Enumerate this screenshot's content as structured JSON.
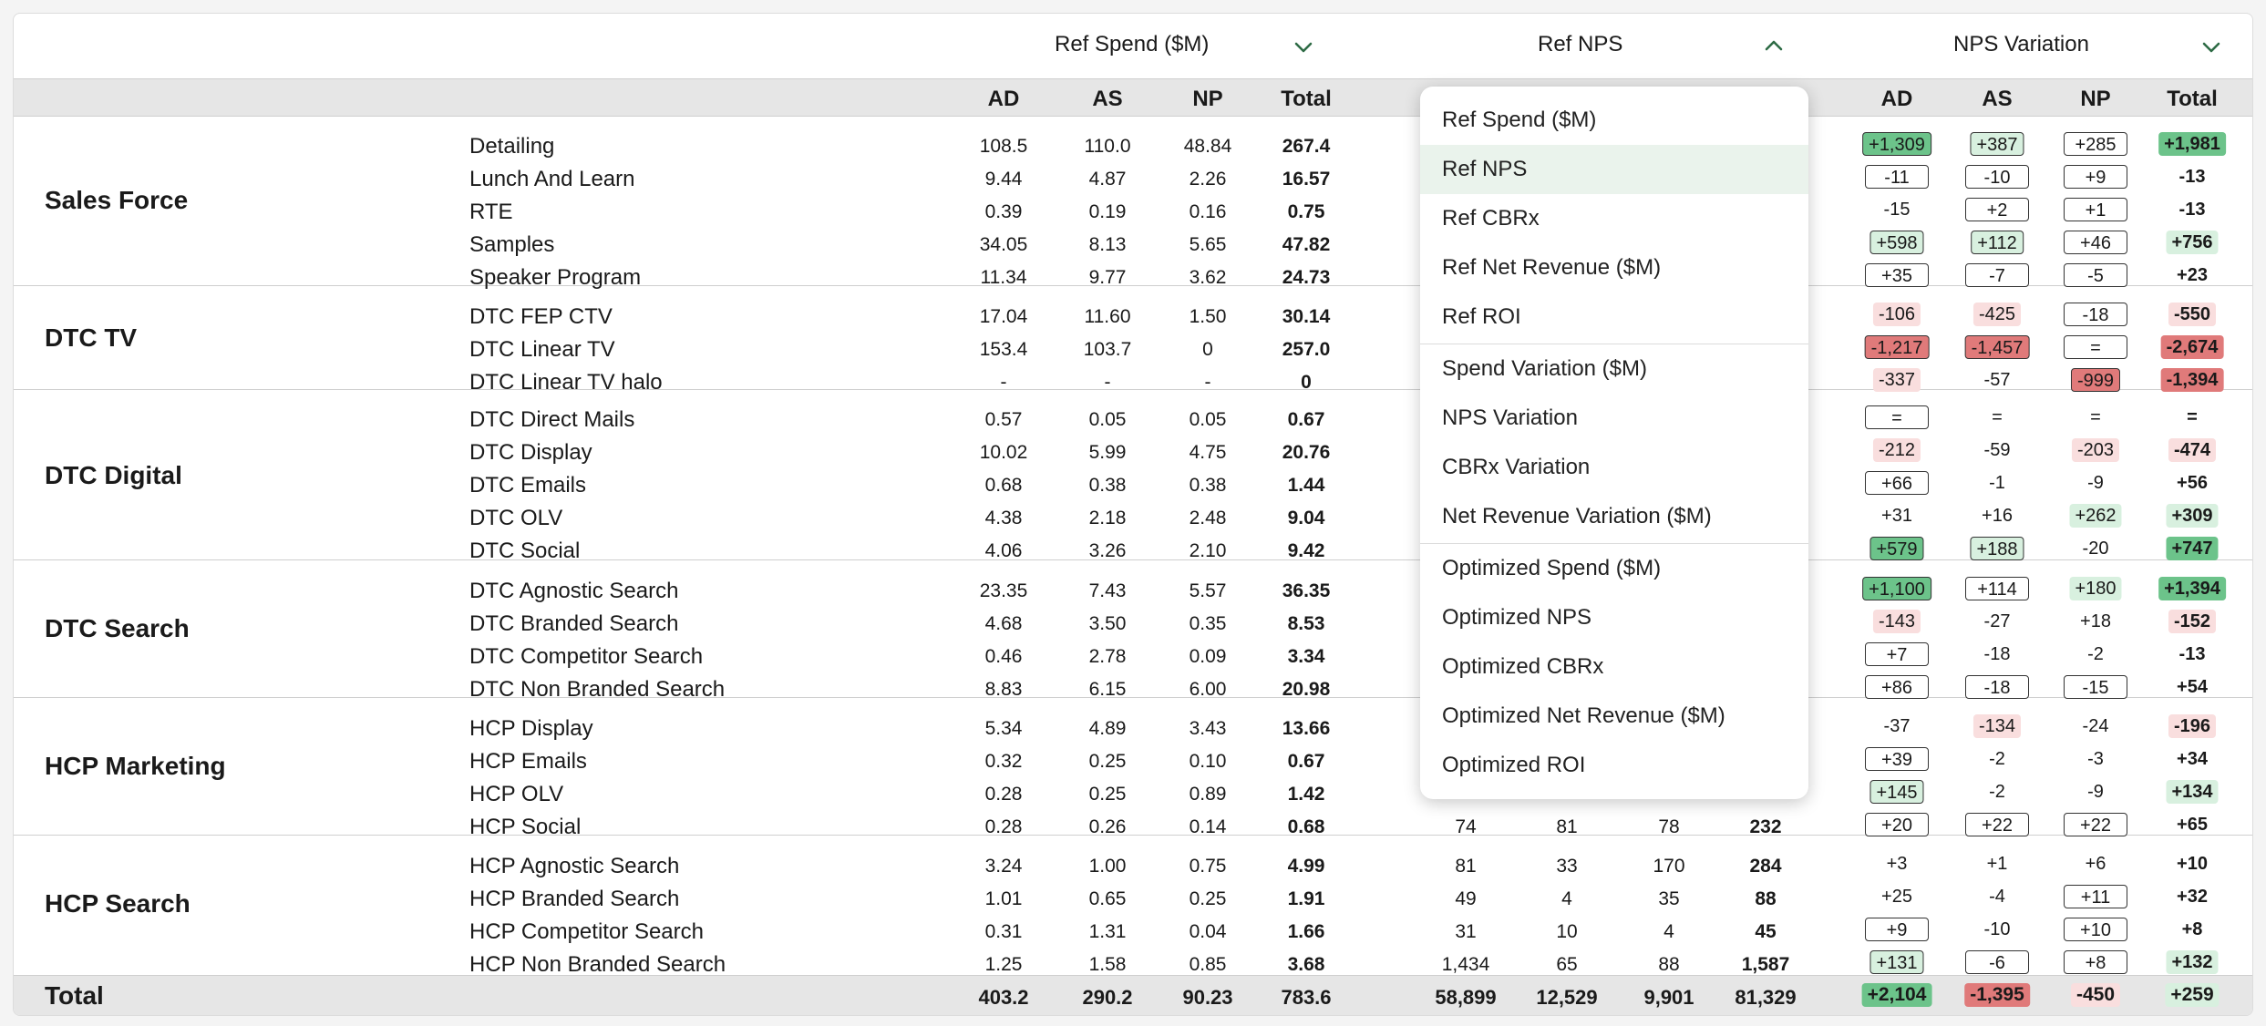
{
  "header": {
    "group1": "Ref Spend ($M)",
    "group2": "Ref NPS",
    "group3": "NPS Variation"
  },
  "subheader": {
    "spend": [
      "AD",
      "AS",
      "NP",
      "Total"
    ],
    "variation": [
      "AD",
      "AS",
      "NP",
      "Total"
    ]
  },
  "sections": [
    {
      "name": "Sales Force"
    },
    {
      "name": "DTC TV"
    },
    {
      "name": "DTC Digital"
    },
    {
      "name": "DTC Search"
    },
    {
      "name": "HCP Marketing"
    },
    {
      "name": "HCP Search"
    }
  ],
  "rows": [
    {
      "channel": "Detailing",
      "spend": [
        "108.5",
        "110.0",
        "48.84",
        "267.4"
      ],
      "nps": [],
      "var": [
        "+1,309",
        "+387",
        "+285",
        "+1,981"
      ]
    },
    {
      "channel": "Lunch And Learn",
      "spend": [
        "9.44",
        "4.87",
        "2.26",
        "16.57"
      ],
      "nps": [],
      "var": [
        "-11",
        "-10",
        "+9",
        "-13"
      ]
    },
    {
      "channel": "RTE",
      "spend": [
        "0.39",
        "0.19",
        "0.16",
        "0.75"
      ],
      "nps": [],
      "var": [
        "-15",
        "+2",
        "+1",
        "-13"
      ]
    },
    {
      "channel": "Samples",
      "spend": [
        "34.05",
        "8.13",
        "5.65",
        "47.82"
      ],
      "nps": [],
      "var": [
        "+598",
        "+112",
        "+46",
        "+756"
      ]
    },
    {
      "channel": "Speaker Program",
      "spend": [
        "11.34",
        "9.77",
        "3.62",
        "24.73"
      ],
      "nps": [],
      "var": [
        "+35",
        "-7",
        "-5",
        "+23"
      ]
    },
    {
      "channel": "DTC FEP CTV",
      "spend": [
        "17.04",
        "11.60",
        "1.50",
        "30.14"
      ],
      "nps": [],
      "var": [
        "-106",
        "-425",
        "-18",
        "-550"
      ]
    },
    {
      "channel": "DTC Linear TV",
      "spend": [
        "153.4",
        "103.7",
        "0",
        "257.0"
      ],
      "nps": [],
      "var": [
        "-1,217",
        "-1,457",
        "=",
        "-2,674"
      ]
    },
    {
      "channel": "DTC Linear TV halo",
      "spend": [
        "-",
        "-",
        "-",
        "0"
      ],
      "nps": [],
      "var": [
        "-337",
        "-57",
        "-999",
        "-1,394"
      ]
    },
    {
      "channel": "DTC Direct Mails",
      "spend": [
        "0.57",
        "0.05",
        "0.05",
        "0.67"
      ],
      "nps": [],
      "var": [
        "=",
        "=",
        "=",
        "="
      ]
    },
    {
      "channel": "DTC Display",
      "spend": [
        "10.02",
        "5.99",
        "4.75",
        "20.76"
      ],
      "nps": [],
      "var": [
        "-212",
        "-59",
        "-203",
        "-474"
      ]
    },
    {
      "channel": "DTC Emails",
      "spend": [
        "0.68",
        "0.38",
        "0.38",
        "1.44"
      ],
      "nps": [],
      "var": [
        "+66",
        "-1",
        "-9",
        "+56"
      ]
    },
    {
      "channel": "DTC OLV",
      "spend": [
        "4.38",
        "2.18",
        "2.48",
        "9.04"
      ],
      "nps": [],
      "var": [
        "+31",
        "+16",
        "+262",
        "+309"
      ]
    },
    {
      "channel": "DTC Social",
      "spend": [
        "4.06",
        "3.26",
        "2.10",
        "9.42"
      ],
      "nps": [],
      "var": [
        "+579",
        "+188",
        "-20",
        "+747"
      ]
    },
    {
      "channel": "DTC Agnostic Search",
      "spend": [
        "23.35",
        "7.43",
        "5.57",
        "36.35"
      ],
      "nps": [],
      "var": [
        "+1,100",
        "+114",
        "+180",
        "+1,394"
      ]
    },
    {
      "channel": "DTC Branded Search",
      "spend": [
        "4.68",
        "3.50",
        "0.35",
        "8.53"
      ],
      "nps": [],
      "var": [
        "-143",
        "-27",
        "+18",
        "-152"
      ]
    },
    {
      "channel": "DTC Competitor Search",
      "spend": [
        "0.46",
        "2.78",
        "0.09",
        "3.34"
      ],
      "nps": [],
      "var": [
        "+7",
        "-18",
        "-2",
        "-13"
      ]
    },
    {
      "channel": "DTC Non Branded Search",
      "spend": [
        "8.83",
        "6.15",
        "6.00",
        "20.98"
      ],
      "nps": [],
      "var": [
        "+86",
        "-18",
        "-15",
        "+54"
      ]
    },
    {
      "channel": "HCP Display",
      "spend": [
        "5.34",
        "4.89",
        "3.43",
        "13.66"
      ],
      "nps": [],
      "var": [
        "-37",
        "-134",
        "-24",
        "-196"
      ]
    },
    {
      "channel": "HCP Emails",
      "spend": [
        "0.32",
        "0.25",
        "0.10",
        "0.67"
      ],
      "nps": [],
      "var": [
        "+39",
        "-2",
        "-3",
        "+34"
      ]
    },
    {
      "channel": "HCP OLV",
      "spend": [
        "0.28",
        "0.25",
        "0.89",
        "1.42"
      ],
      "nps": [],
      "var": [
        "+145",
        "-2",
        "-9",
        "+134"
      ]
    },
    {
      "channel": "HCP Social",
      "spend": [
        "0.28",
        "0.26",
        "0.14",
        "0.68"
      ],
      "nps": [
        "74",
        "81",
        "78",
        "232"
      ],
      "var": [
        "+20",
        "+22",
        "+22",
        "+65"
      ]
    },
    {
      "channel": "HCP Agnostic Search",
      "spend": [
        "3.24",
        "1.00",
        "0.75",
        "4.99"
      ],
      "nps": [
        "81",
        "33",
        "170",
        "284"
      ],
      "var": [
        "+3",
        "+1",
        "+6",
        "+10"
      ]
    },
    {
      "channel": "HCP Branded Search",
      "spend": [
        "1.01",
        "0.65",
        "0.25",
        "1.91"
      ],
      "nps": [
        "49",
        "4",
        "35",
        "88"
      ],
      "var": [
        "+25",
        "-4",
        "+11",
        "+32"
      ]
    },
    {
      "channel": "HCP Competitor Search",
      "spend": [
        "0.31",
        "1.31",
        "0.04",
        "1.66"
      ],
      "nps": [
        "31",
        "10",
        "4",
        "45"
      ],
      "var": [
        "+9",
        "-10",
        "+10",
        "+8"
      ]
    },
    {
      "channel": "HCP Non Branded Search",
      "spend": [
        "1.25",
        "1.58",
        "0.85",
        "3.68"
      ],
      "nps": [
        "1,434",
        "65",
        "88",
        "1,587"
      ],
      "var": [
        "+131",
        "-6",
        "+8",
        "+132"
      ]
    }
  ],
  "total": {
    "label": "Total",
    "spend": [
      "403.2",
      "290.2",
      "90.23",
      "783.6"
    ],
    "nps": [
      "58,899",
      "12,529",
      "9,901",
      "81,329"
    ],
    "var": [
      "+2,104",
      "-1,395",
      "-450",
      "+259"
    ]
  },
  "dropdown": {
    "items": [
      "Ref Spend ($M)",
      "Ref NPS",
      "Ref CBRx",
      "Ref Net Revenue ($M)",
      "Ref ROI",
      "Spend Variation ($M)",
      "NPS Variation",
      "CBRx Variation",
      "Net Revenue Variation ($M)",
      "Optimized Spend ($M)",
      "Optimized NPS",
      "Optimized CBRx",
      "Optimized Net Revenue ($M)",
      "Optimized ROI"
    ],
    "selected": "Ref NPS"
  },
  "colors": {
    "strong_green": "#6cc38a",
    "light_green": "#d8f0df",
    "strong_red": "#e07a7a",
    "light_red": "#f9dede",
    "selected_item": "#eaf3ec",
    "chevron": "#2e6b45"
  },
  "icons": {
    "collapsed": "chevron-down-icon",
    "expanded": "chevron-up-icon"
  }
}
